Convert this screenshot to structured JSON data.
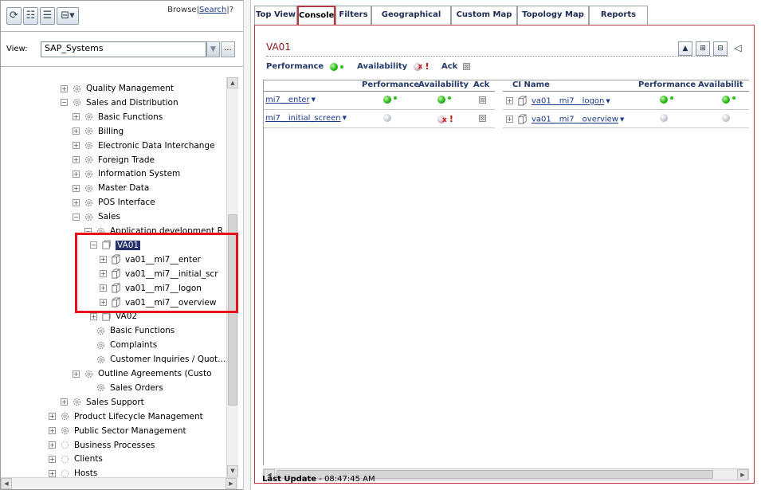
{
  "left_pane": {
    "links": {
      "browse": "Browse",
      "search": "Search",
      "help": "?"
    },
    "view": {
      "label": "View:",
      "value": "SAP_Systems",
      "more": "..."
    },
    "tree": [
      {
        "label": "Quality Management",
        "expander": "+",
        "icon": "gear-icon"
      },
      {
        "label": "Sales and Distribution",
        "expander": "−",
        "icon": "gear-icon"
      },
      {
        "label": "Basic Functions",
        "expander": "+",
        "icon": "gear-icon"
      },
      {
        "label": "Billing",
        "expander": "+",
        "icon": "gear-icon"
      },
      {
        "label": "Electronic Data Interchange",
        "expander": "+",
        "icon": "gear-icon"
      },
      {
        "label": "Foreign Trade",
        "expander": "+",
        "icon": "gear-icon"
      },
      {
        "label": "Information System",
        "expander": "+",
        "icon": "gear-icon"
      },
      {
        "label": "Master Data",
        "expander": "+",
        "icon": "gear-icon"
      },
      {
        "label": "POS Interface",
        "expander": "+",
        "icon": "gear-icon"
      },
      {
        "label": "Sales",
        "expander": "−",
        "icon": "gear-icon"
      },
      {
        "label": "Application development R...",
        "expander": "−",
        "icon": "gear-icon"
      },
      {
        "label": "VA01",
        "expander": "−",
        "icon": "transaction-icon",
        "selected": true
      },
      {
        "label": "va01__mi7__enter",
        "expander": "+",
        "icon": "cube-icon"
      },
      {
        "label": "va01__mi7__initial_scr",
        "expander": "+",
        "icon": "cube-icon"
      },
      {
        "label": "va01__mi7__logon",
        "expander": "+",
        "icon": "cube-icon"
      },
      {
        "label": "va01__mi7__overview",
        "expander": "+",
        "icon": "cube-icon"
      },
      {
        "label": "VA02",
        "expander": "+",
        "icon": "transaction-icon"
      },
      {
        "label": "Basic Functions",
        "expander": "",
        "icon": "gear-icon"
      },
      {
        "label": "Complaints",
        "expander": "",
        "icon": "gear-icon"
      },
      {
        "label": "Customer Inquiries / Quot...",
        "expander": "",
        "icon": "gear-icon"
      },
      {
        "label": "Outline Agreements (Custo",
        "expander": "+",
        "icon": "gear-icon"
      },
      {
        "label": "Sales Orders",
        "expander": "",
        "icon": "gear-icon"
      },
      {
        "label": "Sales Support",
        "expander": "+",
        "icon": "gear-icon"
      },
      {
        "label": "Product Lifecycle Management",
        "expander": "+",
        "icon": "gear-icon"
      },
      {
        "label": "Public Sector Management",
        "expander": "+",
        "icon": "gear-icon"
      },
      {
        "label": "Business Processes",
        "expander": "+",
        "icon": "dashed-gear-icon"
      },
      {
        "label": "Clients",
        "expander": "+",
        "icon": "dashed-gear-icon"
      },
      {
        "label": "Hosts",
        "expander": "+",
        "icon": "dashed-gear-icon"
      }
    ]
  },
  "tabs": [
    {
      "label": "Top View"
    },
    {
      "label": "Console",
      "active": true
    },
    {
      "label": "Filters"
    },
    {
      "label": "Geographical Map"
    },
    {
      "label": "Custom Map"
    },
    {
      "label": "Topology Map"
    },
    {
      "label": "Reports"
    }
  ],
  "console": {
    "title": "VA01",
    "legend": {
      "performance": "Performance",
      "availability": "Availability",
      "ack": "Ack"
    },
    "left_table": {
      "headers": {
        "performance": "Performance",
        "availability": "Availability",
        "ack": "Ack"
      },
      "rows": [
        {
          "name": "mi7__enter",
          "performance": "ok",
          "availability": "ok"
        },
        {
          "name": "mi7__initial_screen",
          "performance": "no-data",
          "availability": "error"
        }
      ]
    },
    "right_table": {
      "headers": {
        "ci_name": "CI Name",
        "performance": "Performance",
        "availability": "Availabilit"
      },
      "rows": [
        {
          "name": "va01__mi7__logon",
          "performance": "ok",
          "availability": "ok"
        },
        {
          "name": "va01__mi7__overview",
          "performance": "no-data",
          "availability": "no-data"
        }
      ]
    },
    "last_update": {
      "label": "Last Update",
      "value": "- 08:47:45 AM"
    }
  },
  "colors": {
    "accent_red": "#b9373a",
    "selection": "#22306e",
    "link": "#1a3b8c",
    "ok_green": "#29b818"
  }
}
